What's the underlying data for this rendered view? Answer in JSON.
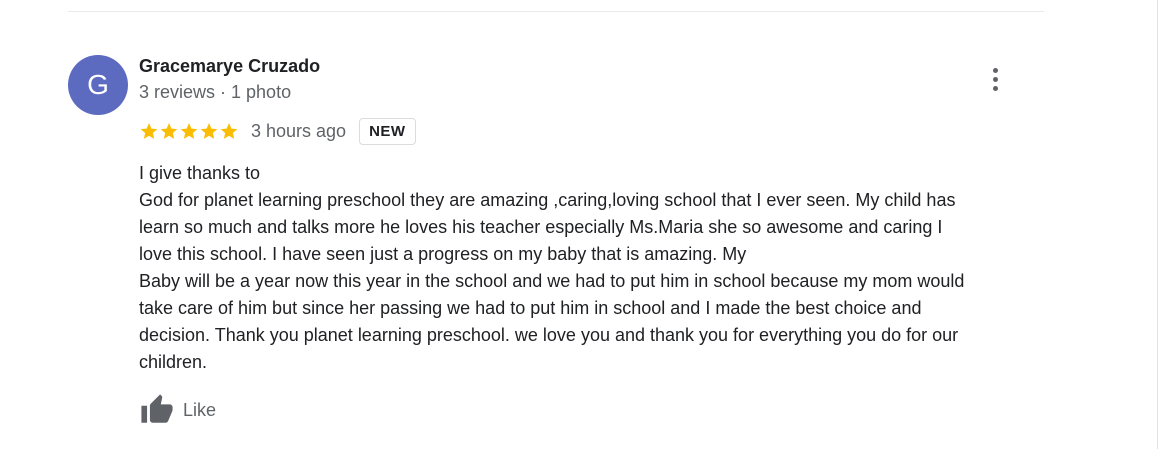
{
  "review": {
    "author_initial": "G",
    "author_name": "Gracemarye Cruzado",
    "author_meta": "3 reviews · 1 photo",
    "rating": 5,
    "time_ago": "3 hours ago",
    "badge": "NEW",
    "text_lines": [
      "I give thanks to",
      "God for planet learning preschool they are amazing ,caring,loving school that I ever seen. My child has",
      "learn so much and talks more he loves his teacher especially Ms.Maria she so awesome and caring I",
      "love this school. I have seen just a progress on my baby that is amazing. My",
      "Baby will be a year now this year in the school and we had to put him in school because my mom would",
      "take care of him but since her passing we had to put him in school and I made the best choice and",
      "decision. Thank you planet learning preschool. we love you and thank you for everything you do for our",
      "children."
    ],
    "like_label": "Like"
  },
  "colors": {
    "avatar_bg": "#5c6bc0",
    "star": "#fbbc04",
    "secondary_text": "#5f6368",
    "primary_text": "#202124"
  },
  "icons": {
    "more": "more-vert-icon",
    "star": "star-icon",
    "like": "thumbs-up-icon"
  }
}
